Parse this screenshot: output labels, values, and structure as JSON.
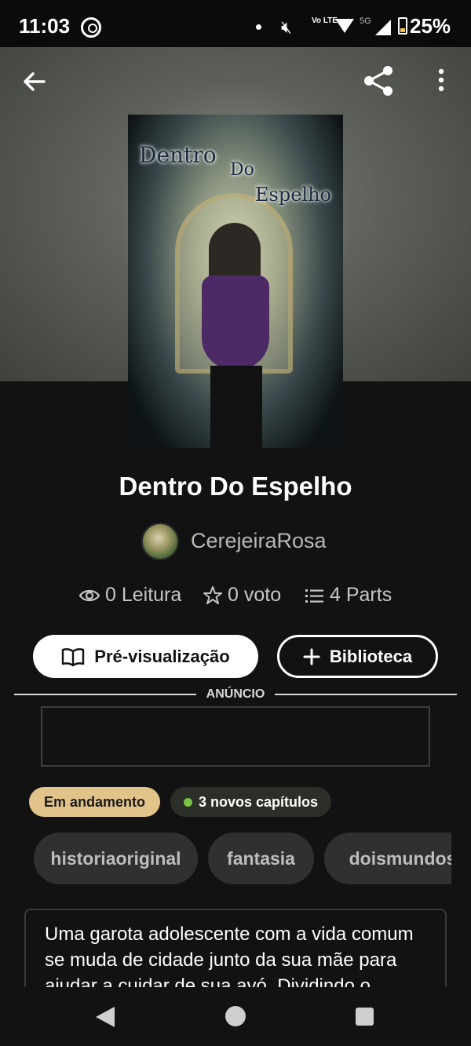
{
  "status_bar": {
    "time": "11:03",
    "network_volte": "Vo LTE",
    "network_5g": "5G",
    "battery": "25%"
  },
  "header": {
    "back_icon": "arrow-left-icon",
    "share_icon": "share-icon",
    "more_icon": "more-vertical-icon"
  },
  "cover": {
    "line1": "Dentro",
    "line2": "Do",
    "line3": "Espelho"
  },
  "story": {
    "title": "Dentro Do Espelho",
    "author": "CerejeiraRosa",
    "reads": "0 Leitura",
    "votes": "0 voto",
    "parts": "4 Parts"
  },
  "actions": {
    "preview_label": "Pré-visualização",
    "library_label": "Biblioteca"
  },
  "ad": {
    "label": "ANÚNCIO"
  },
  "badges": {
    "status": "Em andamento",
    "new_chapters": "3 novos capítulos"
  },
  "tags": [
    "historiaoriginal",
    "fantasia",
    "doismundos"
  ],
  "description": "Uma garota adolescente com a vida comum se muda de cidade junto da sua mãe para ajudar a cuidar de sua avó. Dividindo o",
  "colors": {
    "background": "#121212",
    "status_badge": "#e2c48a",
    "new_dot": "#79c246"
  }
}
